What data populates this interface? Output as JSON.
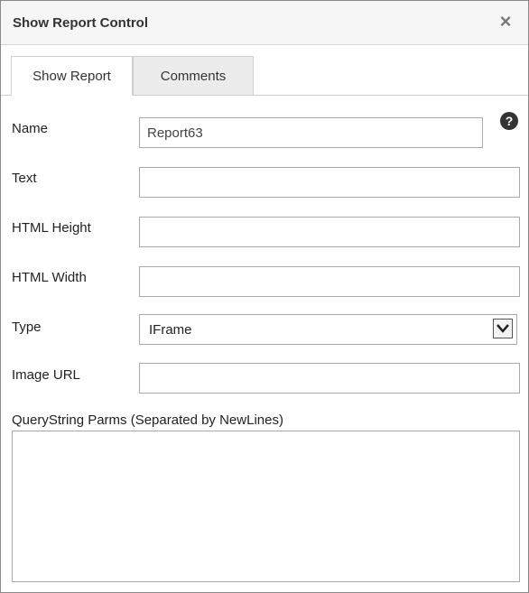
{
  "dialog": {
    "title": "Show Report Control",
    "close_label": "×"
  },
  "tabs": [
    {
      "label": "Show Report",
      "active": true
    },
    {
      "label": "Comments",
      "active": false
    }
  ],
  "help_icon_label": "?",
  "fields": {
    "name": {
      "label": "Name",
      "value": "Report63"
    },
    "text": {
      "label": "Text",
      "value": ""
    },
    "html_height": {
      "label": "HTML Height",
      "value": ""
    },
    "html_width": {
      "label": "HTML Width",
      "value": ""
    },
    "type": {
      "label": "Type",
      "value": "IFrame"
    },
    "image_url": {
      "label": "Image URL",
      "value": ""
    },
    "querystring": {
      "label": "QueryString Parms (Separated by NewLines)",
      "value": ""
    }
  },
  "icons": {
    "close": "close-icon",
    "help": "help-icon",
    "dropdown": "chevron-down-icon"
  }
}
